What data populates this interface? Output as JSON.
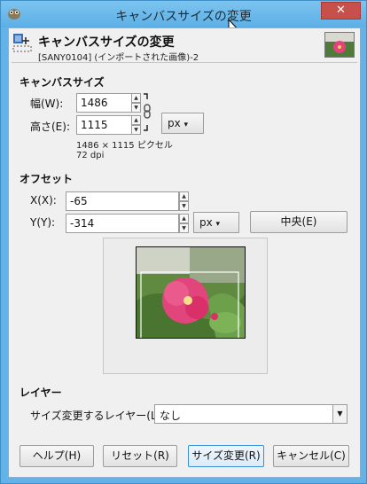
{
  "window": {
    "title": "キャンバスサイズの変更",
    "close_glyph": "✕"
  },
  "header": {
    "title": "キャンバスサイズの変更",
    "subtitle": "[SANY0104] (インポートされた画像)-2"
  },
  "canvas_size": {
    "section": "キャンバスサイズ",
    "width_label": "幅(W):",
    "width_value": "1486",
    "height_label": "高さ(E):",
    "height_value": "1115",
    "unit": "px",
    "pixels_info": "1486 × 1115 ピクセル",
    "dpi_info": "72 dpi"
  },
  "offset": {
    "section": "オフセット",
    "x_label": "X(X):",
    "x_value": "-65",
    "y_label": "Y(Y):",
    "y_value": "-314",
    "unit": "px",
    "center_button": "中央(E)"
  },
  "layer": {
    "section": "レイヤー",
    "resize_label": "サイズ変更するレイヤー(L):",
    "resize_value": "なし"
  },
  "buttons": {
    "help": "ヘルプ(H)",
    "reset": "リセット(R)",
    "resize": "サイズ変更(R)",
    "cancel": "キャンセル(C)"
  },
  "icons": {
    "app": "gimp-icon",
    "close": "close-icon",
    "header": "canvas-size-icon",
    "chain": "chain-link-icon",
    "dropdown": "chevron-down-icon"
  }
}
